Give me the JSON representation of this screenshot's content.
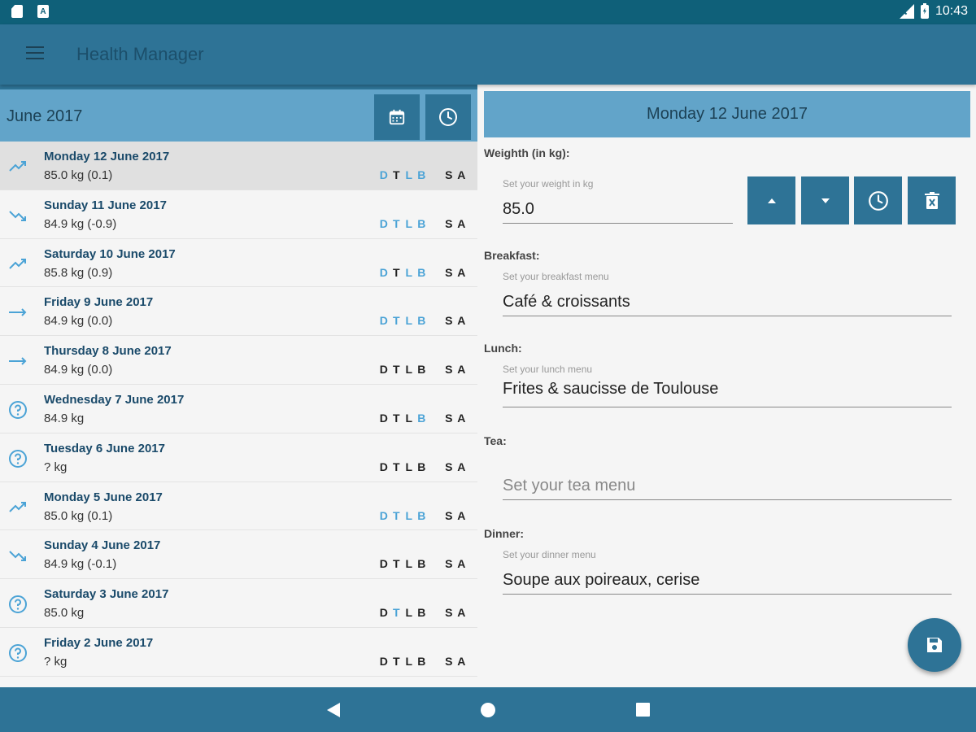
{
  "status_bar": {
    "time": "10:43"
  },
  "app_bar": {
    "title": "Health Manager"
  },
  "left_panel": {
    "month_title": "June 2017",
    "days": [
      {
        "title": "Monday 12 June 2017",
        "weight": "85.0 kg (0.1)",
        "trend": "up",
        "selected": true,
        "flags": [
          "D",
          "T",
          "L",
          "B",
          "S",
          "A"
        ],
        "on": [
          true,
          false,
          true,
          true,
          false,
          false
        ]
      },
      {
        "title": "Sunday 11 June 2017",
        "weight": "84.9 kg (-0.9)",
        "trend": "down",
        "selected": false,
        "flags": [
          "D",
          "T",
          "L",
          "B",
          "S",
          "A"
        ],
        "on": [
          true,
          true,
          true,
          true,
          false,
          false
        ]
      },
      {
        "title": "Saturday 10 June 2017",
        "weight": "85.8 kg (0.9)",
        "trend": "up",
        "selected": false,
        "flags": [
          "D",
          "T",
          "L",
          "B",
          "S",
          "A"
        ],
        "on": [
          true,
          false,
          true,
          true,
          false,
          false
        ]
      },
      {
        "title": "Friday 9 June 2017",
        "weight": "84.9 kg (0.0)",
        "trend": "flat",
        "selected": false,
        "flags": [
          "D",
          "T",
          "L",
          "B",
          "S",
          "A"
        ],
        "on": [
          true,
          true,
          true,
          true,
          false,
          false
        ]
      },
      {
        "title": "Thursday 8 June 2017",
        "weight": "84.9 kg (0.0)",
        "trend": "flat",
        "selected": false,
        "flags": [
          "D",
          "T",
          "L",
          "B",
          "S",
          "A"
        ],
        "on": [
          false,
          false,
          false,
          false,
          false,
          false
        ]
      },
      {
        "title": "Wednesday 7 June 2017",
        "weight": "84.9 kg",
        "trend": "unknown",
        "selected": false,
        "flags": [
          "D",
          "T",
          "L",
          "B",
          "S",
          "A"
        ],
        "on": [
          false,
          false,
          false,
          true,
          false,
          false
        ]
      },
      {
        "title": "Tuesday 6 June 2017",
        "weight": "? kg",
        "trend": "unknown",
        "selected": false,
        "flags": [
          "D",
          "T",
          "L",
          "B",
          "S",
          "A"
        ],
        "on": [
          false,
          false,
          false,
          false,
          false,
          false
        ]
      },
      {
        "title": "Monday 5 June 2017",
        "weight": "85.0 kg (0.1)",
        "trend": "up",
        "selected": false,
        "flags": [
          "D",
          "T",
          "L",
          "B",
          "S",
          "A"
        ],
        "on": [
          true,
          true,
          true,
          true,
          false,
          false
        ]
      },
      {
        "title": "Sunday 4 June 2017",
        "weight": "84.9 kg (-0.1)",
        "trend": "down",
        "selected": false,
        "flags": [
          "D",
          "T",
          "L",
          "B",
          "S",
          "A"
        ],
        "on": [
          false,
          false,
          false,
          false,
          false,
          false
        ]
      },
      {
        "title": "Saturday 3 June 2017",
        "weight": "85.0 kg",
        "trend": "unknown",
        "selected": false,
        "flags": [
          "D",
          "T",
          "L",
          "B",
          "S",
          "A"
        ],
        "on": [
          false,
          true,
          false,
          false,
          false,
          false
        ]
      },
      {
        "title": "Friday 2 June 2017",
        "weight": "? kg",
        "trend": "unknown",
        "selected": false,
        "flags": [
          "D",
          "T",
          "L",
          "B",
          "S",
          "A"
        ],
        "on": [
          false,
          false,
          false,
          false,
          false,
          false
        ]
      }
    ]
  },
  "detail": {
    "date_title": "Monday 12 June 2017",
    "weight": {
      "label": "Weighth (in kg):",
      "hint": "Set your weight in kg",
      "value": "85.0"
    },
    "breakfast": {
      "label": "Breakfast:",
      "hint": "Set your breakfast menu",
      "value": "Café & croissants"
    },
    "lunch": {
      "label": "Lunch:",
      "hint": "Set your lunch menu",
      "value": "Frites & saucisse de Toulouse"
    },
    "tea": {
      "label": "Tea:",
      "placeholder": "Set your tea menu"
    },
    "dinner": {
      "label": "Dinner:",
      "hint": "Set your dinner menu",
      "value": "Soupe aux poireaux, cerise"
    }
  },
  "colors": {
    "primary": "#2e7396",
    "header_light": "#62a4c9",
    "status_bar": "#0f6079",
    "flag_on": "#4ba3d6"
  },
  "icons": {
    "menu": "hamburger-icon",
    "calendar": "calendar-icon",
    "clock": "clock-icon",
    "up": "arrow-up-icon",
    "down": "arrow-down-icon",
    "delete": "delete-icon",
    "save": "save-icon"
  }
}
